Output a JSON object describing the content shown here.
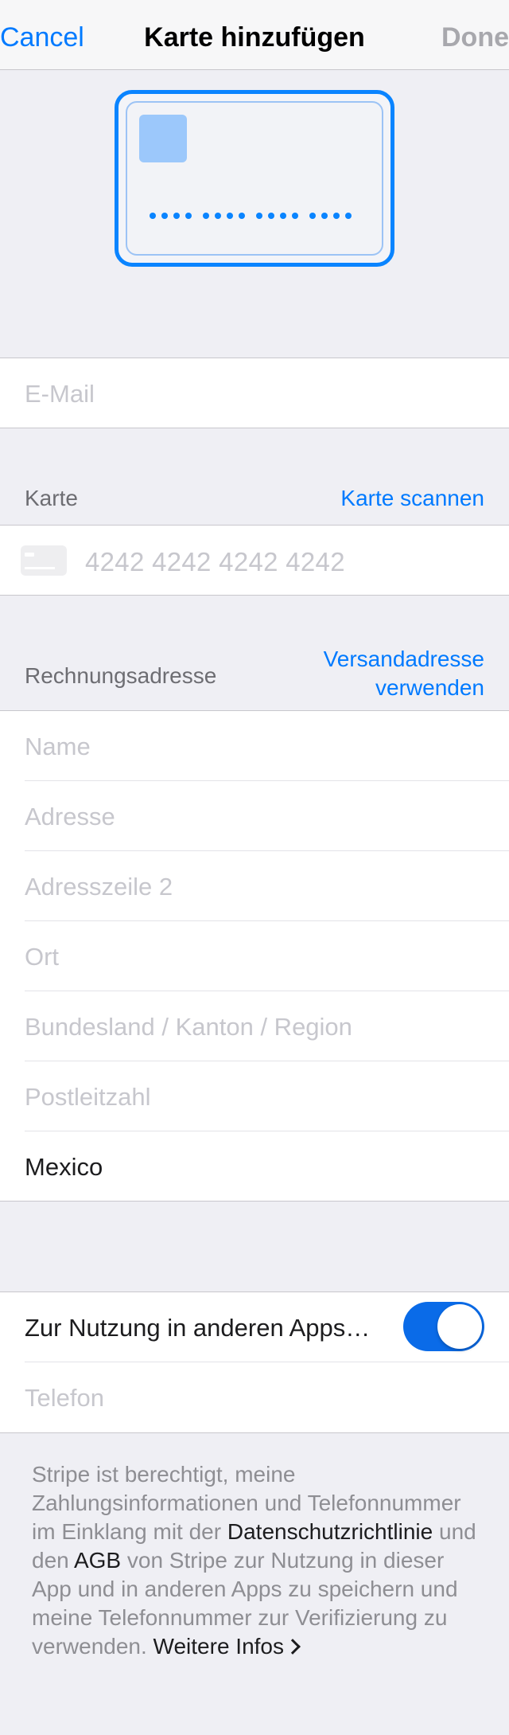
{
  "navbar": {
    "cancel_label": "Cancel",
    "title": "Karte hinzufügen",
    "done_label": "Done"
  },
  "email": {
    "placeholder": "E-Mail"
  },
  "card_section": {
    "header": "Karte",
    "scan_label": "Karte scannen",
    "card_number_placeholder": "4242 4242 4242 4242",
    "card_icon": "credit-card-icon"
  },
  "billing_section": {
    "header": "Rechnungsadresse",
    "use_shipping_line1": "Versandadresse",
    "use_shipping_line2": "verwenden",
    "fields": {
      "name": "Name",
      "address": "Adresse",
      "address2": "Adresszeile 2",
      "city": "Ort",
      "state": "Bundesland / Kanton / Region",
      "postal": "Postleitzahl",
      "country": "Mexico"
    }
  },
  "link_section": {
    "toggle_label": "Zur Nutzung in anderen Apps…",
    "toggle_on": true,
    "phone_placeholder": "Telefon"
  },
  "footer": {
    "part1": "Stripe ist berechtigt, meine Zahlungsinformationen und Telefonnummer im Einklang mit der ",
    "privacy_link": "Datenschutzrichtlinie",
    "part2": " und den ",
    "terms_link": "AGB",
    "part3": " von Stripe zur Nutzung in dieser App und in anderen Apps zu speichern und meine Telefonnummer zur Verifizierung zu verwenden. ",
    "more_info_link": "Weitere Infos"
  },
  "colors": {
    "accent": "#007aff",
    "toggle_on": "#0a6be8",
    "background": "#efeff4",
    "placeholder": "#c7c7cd"
  }
}
